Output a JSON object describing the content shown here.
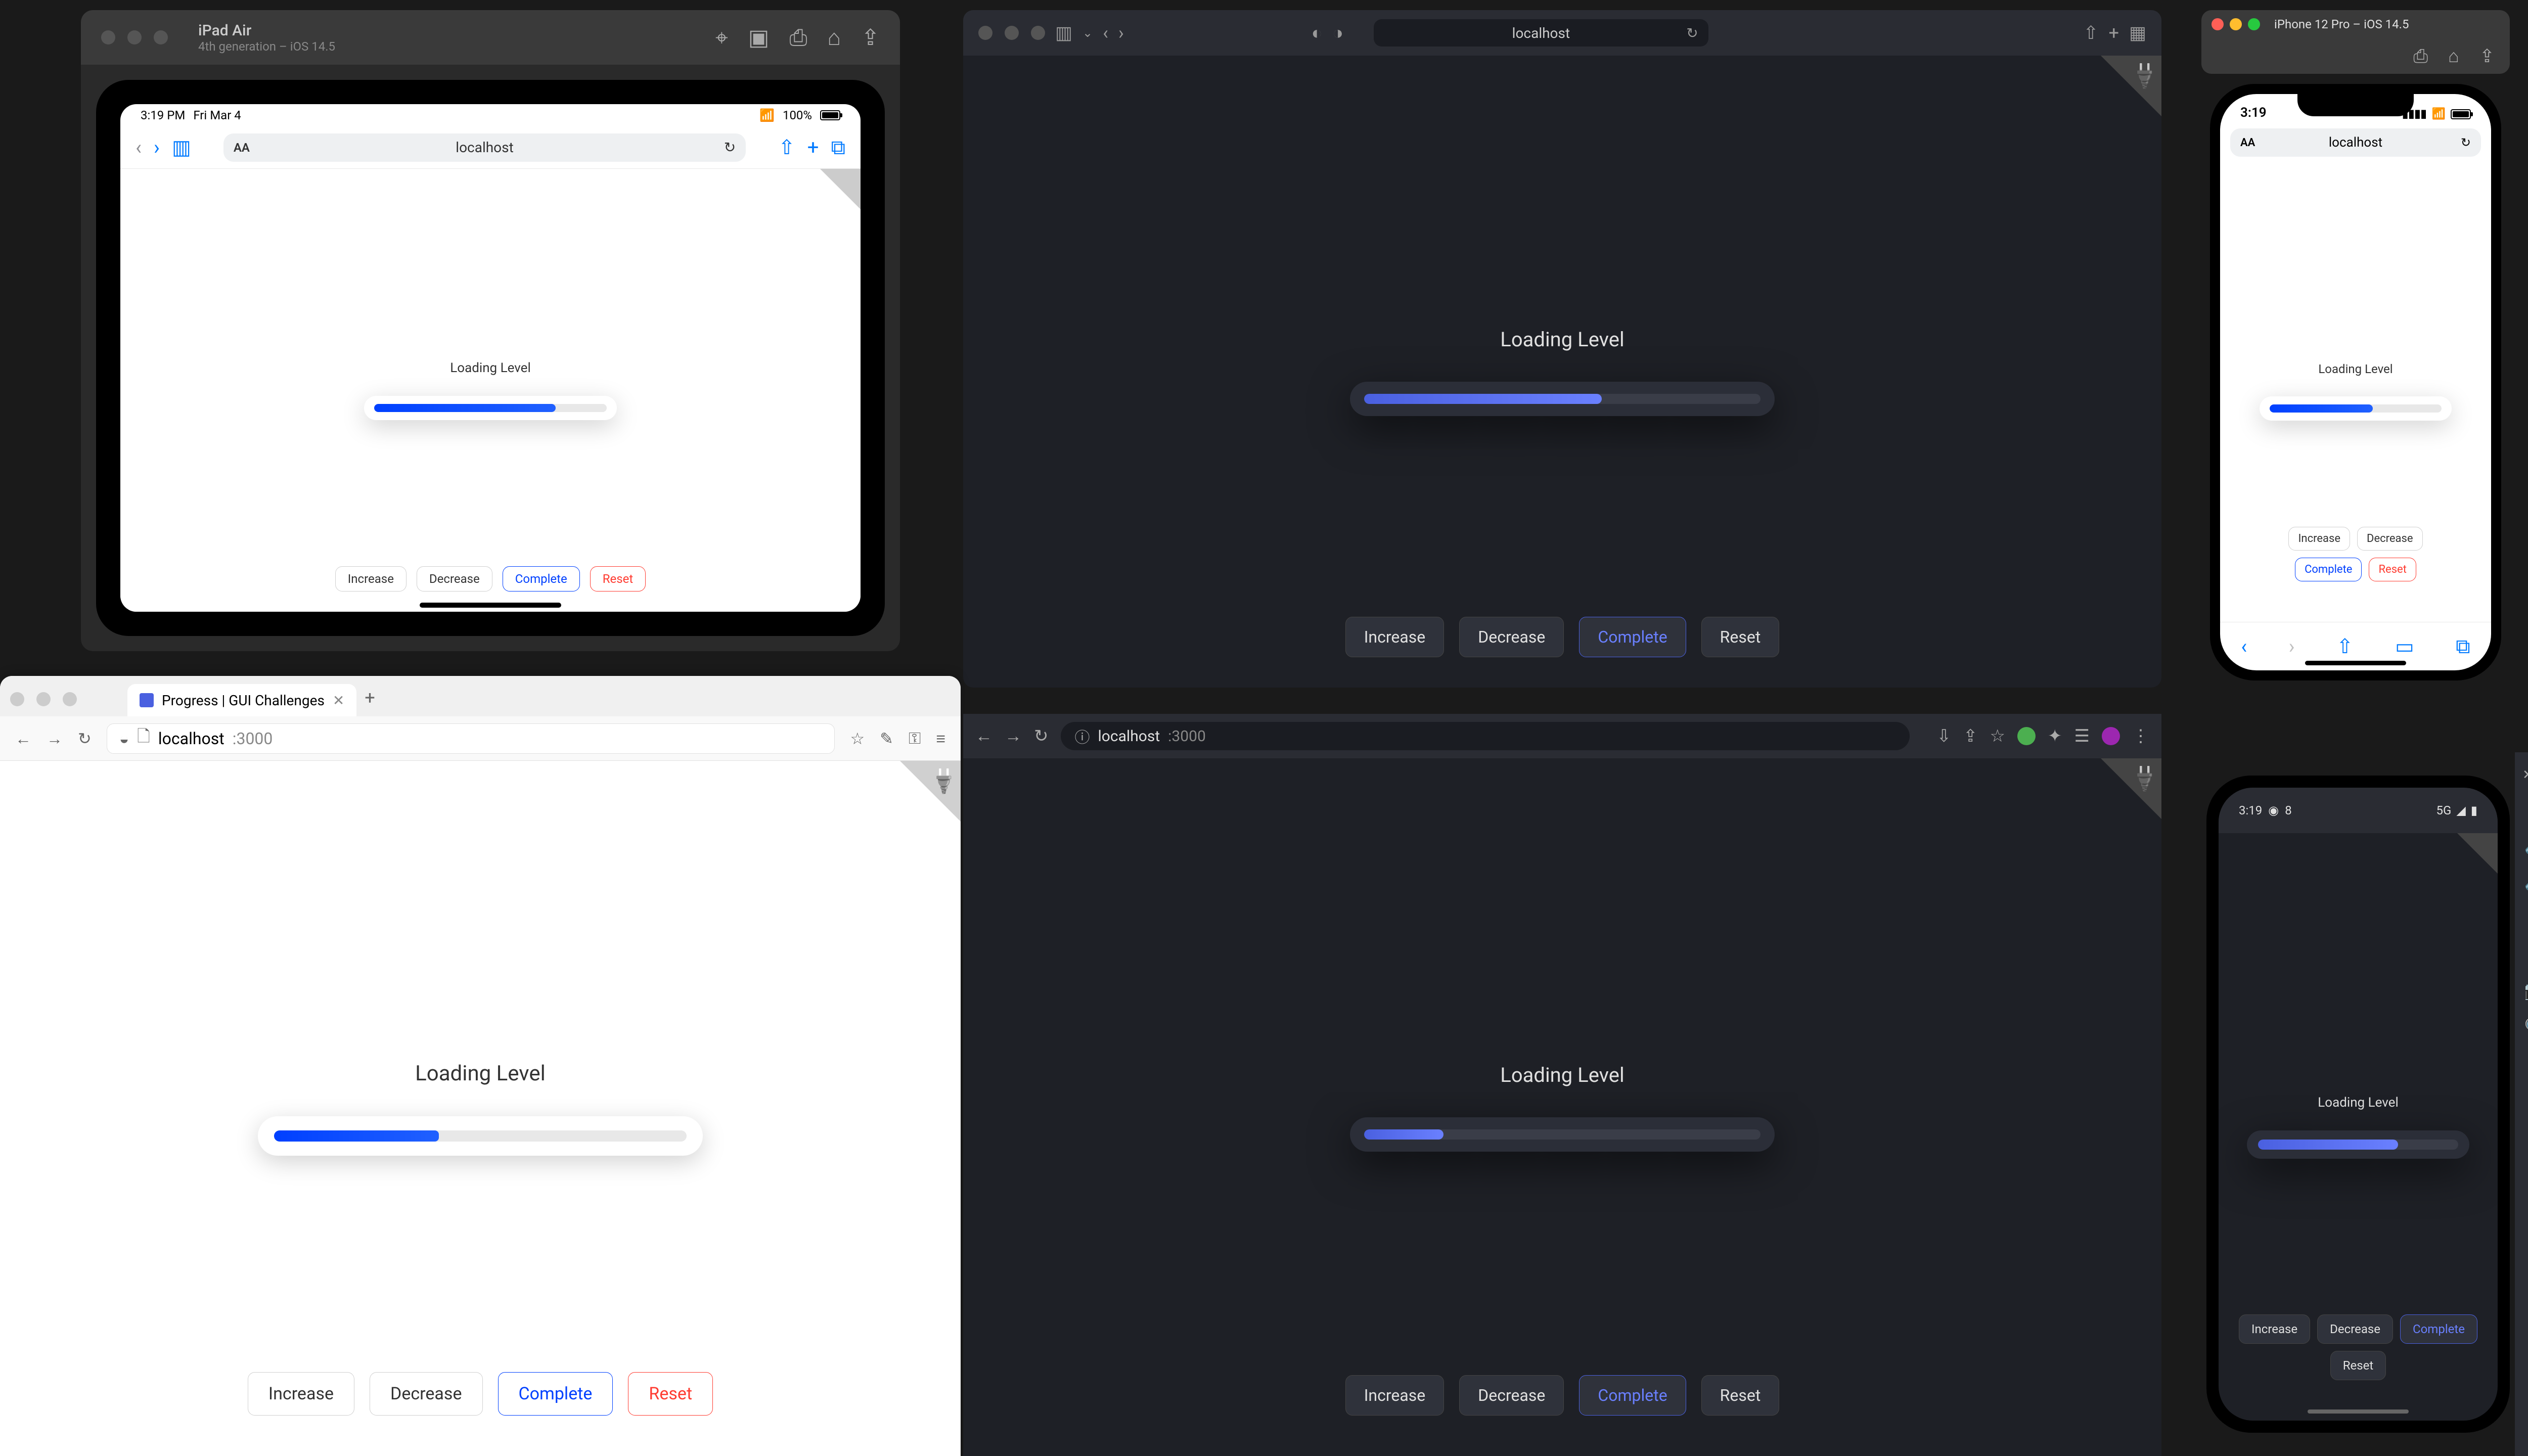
{
  "demo": {
    "label": "Loading Level",
    "buttons": {
      "increase": "Increase",
      "decrease": "Decrease",
      "complete": "Complete",
      "reset": "Reset"
    }
  },
  "ipad": {
    "window_title": "iPad Air",
    "window_subtitle": "4th generation – iOS 14.5",
    "status_time": "3:19 PM",
    "status_date": "Fri Mar 4",
    "battery_text": "100%",
    "url_text": "localhost",
    "progress_pct": 78
  },
  "safari": {
    "url_text": "localhost",
    "progress_pct": 60
  },
  "iphone": {
    "window_title": "iPhone 12 Pro – iOS 14.5",
    "status_time": "3:19",
    "url_text": "localhost",
    "progress_pct": 60
  },
  "firefox": {
    "tab_title": "Progress | GUI Challenges",
    "url_host": "localhost",
    "url_port": ":3000",
    "progress_pct": 40
  },
  "chrome": {
    "url_host": "localhost",
    "url_port": ":3000",
    "progress_pct": 20
  },
  "android": {
    "status_time": "3:19",
    "status_misc": "8",
    "status_right": "5G",
    "progress_pct": 70
  },
  "colors": {
    "accent_light": "#0040ff",
    "accent_dark": "#6a80ff",
    "danger": "#ff3b30"
  }
}
